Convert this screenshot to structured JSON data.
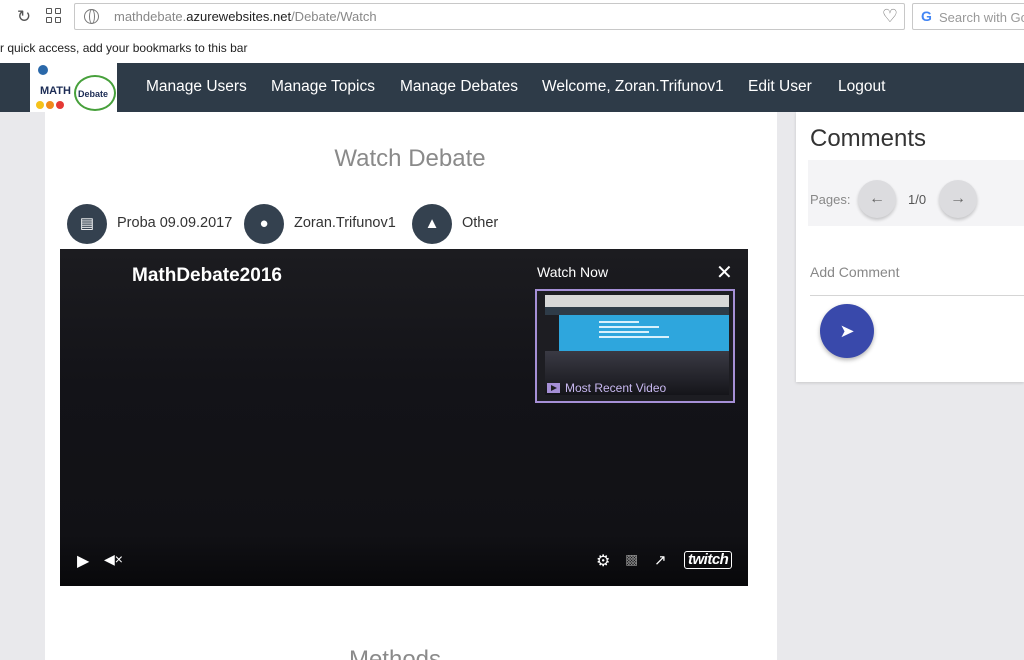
{
  "browser": {
    "url_prefix": "mathdebate.",
    "url_host": "azurewebsites.net",
    "url_path": "/Debate/Watch",
    "search_placeholder": "Search with Goo",
    "bookmarks_hint": "r quick access, add your bookmarks to this bar"
  },
  "logo": {
    "math": "MATH",
    "debate": "Debate"
  },
  "nav": {
    "items": [
      "Manage Users",
      "Manage Topics",
      "Manage Debates",
      "Welcome, Zoran.Trifunov1",
      "Edit User",
      "Logout"
    ]
  },
  "main": {
    "title": "Watch Debate",
    "meta": {
      "topic": "Proba 09.09.2017",
      "author": "Zoran.Trifunov1",
      "category": "Other"
    },
    "next_section": "Methods"
  },
  "player": {
    "channel": "MathDebate2016",
    "watch_now": "Watch Now",
    "close": "✕",
    "recent_label": "Most Recent Video",
    "brand": "twitch"
  },
  "comments": {
    "title": "Comments",
    "pages_label": "Pages:",
    "page_count": "1/0",
    "add_placeholder": "Add Comment"
  },
  "colors": {
    "nav_bg": "#2e3b48",
    "accent": "#3949ab",
    "thumb_border": "#a58fd6"
  }
}
